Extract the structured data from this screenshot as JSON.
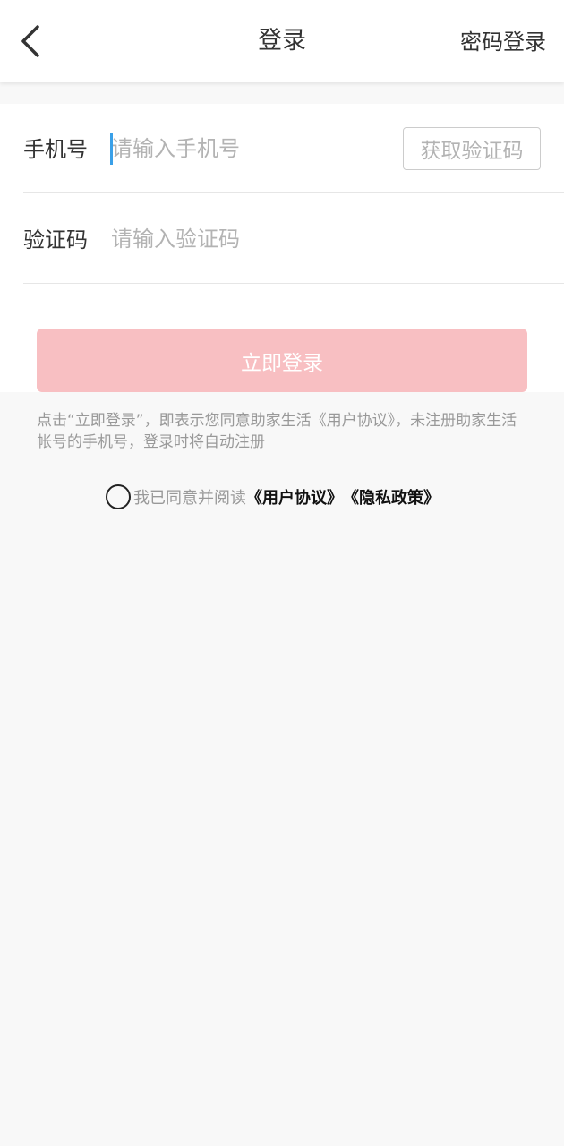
{
  "navbar": {
    "back_icon": "chevron-left-icon",
    "title": "登录",
    "right_link": "密码登录"
  },
  "form": {
    "phone": {
      "label": "手机号",
      "placeholder": "请输入手机号",
      "value": ""
    },
    "code": {
      "label": "验证码",
      "placeholder": "请输入验证码",
      "value": ""
    },
    "get_code_label": "获取验证码",
    "login_label": "立即登录"
  },
  "notice": "点击“立即登录”，即表示您同意助家生活《用户协议》，未注册助家生活帐号的手机号，登录时将自动注册",
  "agreement": {
    "checked": false,
    "prefix": "我已同意并阅读",
    "user_agreement": "《用户协议》",
    "privacy_policy": "《隐私政策》"
  },
  "colors": {
    "background": "#f8f8f8",
    "login_button_disabled": "#f8bfc2",
    "caret": "#3aa0e8"
  }
}
